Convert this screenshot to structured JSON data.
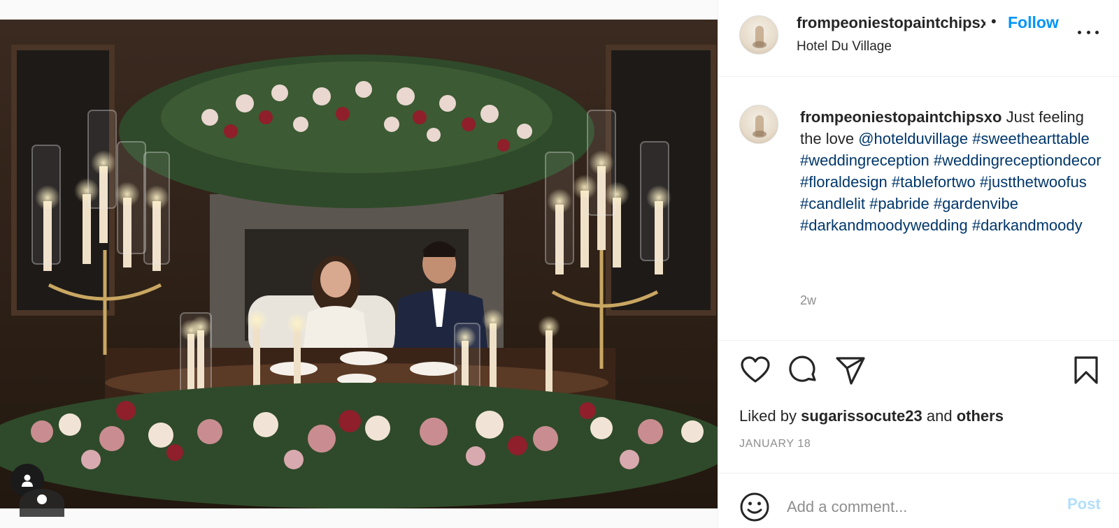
{
  "header": {
    "username": "frompeoniestopaintchipsxo",
    "separator": "•",
    "follow_label": "Follow",
    "location": "Hotel Du Village",
    "more_icon": "more-horizontal-icon"
  },
  "caption": {
    "username": "frompeoniestopaintchipsxo",
    "text": "Just feeling the love",
    "mention": "@hotelduvillage",
    "hashtags": [
      "#sweethearttable",
      "#weddingreception",
      "#weddingreceptiondecor",
      "#floraldesign",
      "#tablefortwo",
      "#justthetwoofus",
      "#candlelit",
      "#pabride",
      "#gardenvibe",
      "#darkandmoodywedding",
      "#darkandmoody"
    ],
    "time_ago": "2w"
  },
  "actions": {
    "like_icon": "heart-icon",
    "comment_icon": "comment-icon",
    "share_icon": "send-icon",
    "save_icon": "bookmark-icon"
  },
  "likes": {
    "prefix": "Liked by",
    "user": "sugarissocute23",
    "conjunction": "and",
    "others": "others"
  },
  "date": "JANUARY 18",
  "comment": {
    "placeholder": "Add a comment...",
    "post_label": "Post"
  },
  "colors": {
    "accent": "#0095f6",
    "link": "#00376b",
    "muted": "#8e8e8e",
    "post_disabled": "#b2dffc"
  }
}
